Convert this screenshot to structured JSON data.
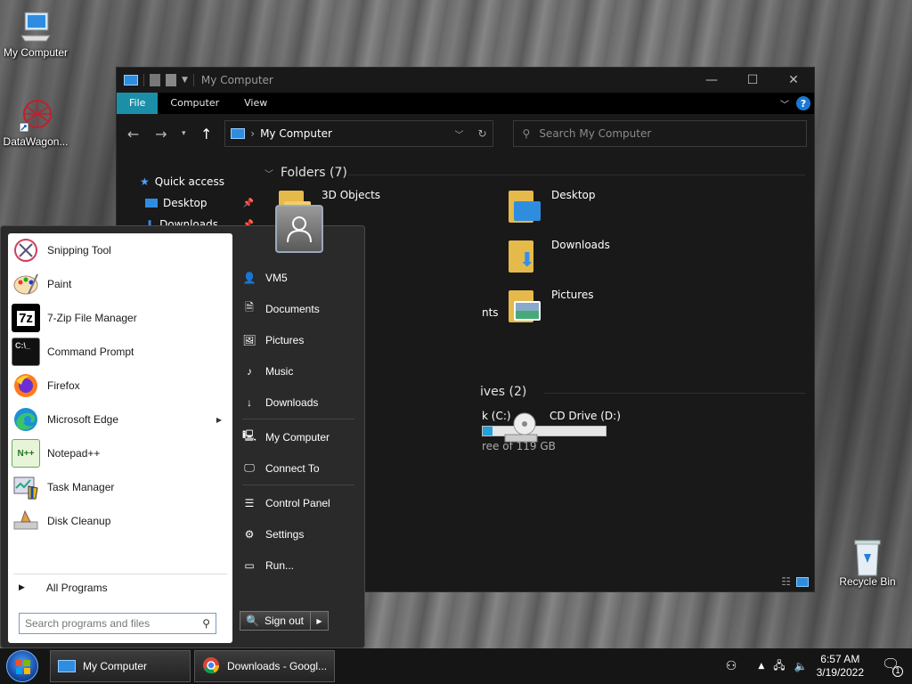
{
  "desktop": {
    "icons": [
      {
        "label": "My Computer"
      },
      {
        "label": "DataWagon..."
      },
      {
        "label": "Recycle Bin"
      }
    ]
  },
  "explorer": {
    "title": "My Computer",
    "ribbon_tabs": [
      "File",
      "Computer",
      "View"
    ],
    "address": "My Computer",
    "search_placeholder": "Search My Computer",
    "nav": {
      "quick_access": "Quick access",
      "items": [
        "Desktop",
        "Downloads"
      ]
    },
    "folders_header": "Folders (7)",
    "folders": [
      "3D Objects",
      "Desktop",
      "Downloads",
      "Pictures"
    ],
    "folder_partial": "nts",
    "drives_header_partial": "ives (2)",
    "drive_c_label_partial": "k (C:)",
    "drive_c_free_partial": "ree of 119 GB",
    "drive_c_used_fraction": 0.08,
    "drive_d_label": "CD Drive (D:)"
  },
  "startmenu": {
    "programs": [
      {
        "label": "Snipping Tool",
        "icon": "snipping-tool-icon"
      },
      {
        "label": "Paint",
        "icon": "paint-icon"
      },
      {
        "label": "7-Zip File Manager",
        "icon": "7zip-icon"
      },
      {
        "label": "Command Prompt",
        "icon": "command-prompt-icon"
      },
      {
        "label": "Firefox",
        "icon": "firefox-icon"
      },
      {
        "label": "Microsoft Edge",
        "icon": "edge-icon",
        "submenu": true
      },
      {
        "label": "Notepad++",
        "icon": "notepad-plus-plus-icon"
      },
      {
        "label": "Task Manager",
        "icon": "task-manager-icon"
      },
      {
        "label": "Disk Cleanup",
        "icon": "disk-cleanup-icon"
      }
    ],
    "all_programs": "All Programs",
    "search_placeholder": "Search programs and files",
    "right_items": [
      "VM5",
      "Documents",
      "Pictures",
      "Music",
      "Downloads",
      "My Computer",
      "Connect To",
      "Control Panel",
      "Settings",
      "Run..."
    ],
    "sign_out": "Sign out"
  },
  "taskbar": {
    "tasks": [
      {
        "label": "My Computer",
        "icon": "computer-icon"
      },
      {
        "label": "Downloads - Googl...",
        "icon": "chrome-icon"
      }
    ],
    "time": "6:57 AM",
    "date": "3/19/2022",
    "notification_count": "1"
  },
  "colors": {
    "accent": "#1c8fa8",
    "window_bg": "#191919",
    "folder_yellow": "#e5b94a"
  }
}
